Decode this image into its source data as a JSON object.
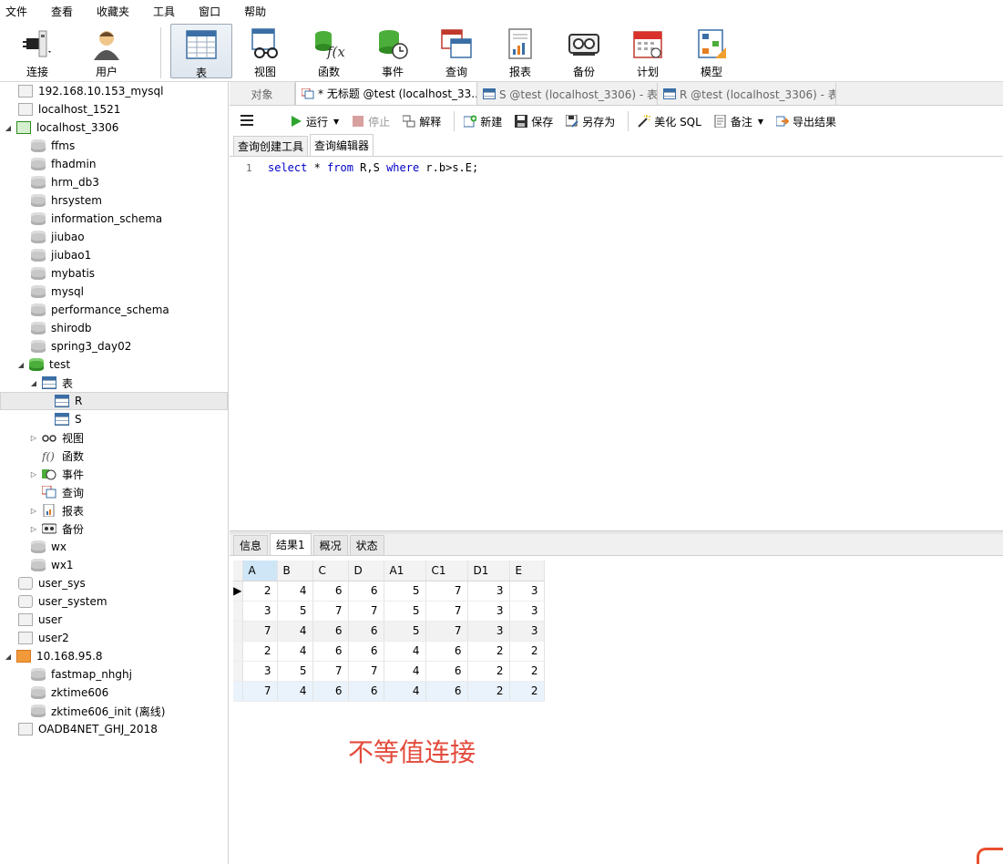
{
  "menu": [
    "文件",
    "查看",
    "收藏夹",
    "工具",
    "窗口",
    "帮助"
  ],
  "toolbar": {
    "connect": "连接",
    "user": "用户",
    "table": "表",
    "view": "视图",
    "function": "函数",
    "event": "事件",
    "query": "查询",
    "report": "报表",
    "backup": "备份",
    "schedule": "计划",
    "model": "模型"
  },
  "tree": {
    "conn1": "192.168.10.153_mysql",
    "conn2": "localhost_1521",
    "conn3": "localhost_3306",
    "dbs": [
      "ffms",
      "fhadmin",
      "hrm_db3",
      "hrsystem",
      "information_schema",
      "jiubao",
      "jiubao1",
      "mybatis",
      "mysql",
      "performance_schema",
      "shirodb",
      "spring3_day02"
    ],
    "test": "test",
    "tables": "表",
    "table_r": "R",
    "table_s": "S",
    "views": "视图",
    "functions": "函数",
    "events": "事件",
    "queries": "查询",
    "reports": "报表",
    "backups": "备份",
    "db_wx": "wx",
    "db_wx1": "wx1",
    "conn_user_sys": "user_sys",
    "conn_user_system": "user_system",
    "conn_user": "user",
    "conn_user2": "user2",
    "conn4": "10.168.95.8",
    "conn4_dbs": [
      "fastmap_nhghj",
      "zktime606",
      "zktime606_init (离线)"
    ],
    "conn5": "OADB4NET_GHJ_2018"
  },
  "tabs": {
    "objects": "对象",
    "query_tab": "* 无标题 @test (localhost_33...",
    "s_tab": "S @test (localhost_3306) - 表",
    "r_tab": "R @test (localhost_3306) - 表"
  },
  "editor_toolbar": {
    "run": "运行",
    "stop": "停止",
    "explain": "解释",
    "new": "新建",
    "save": "保存",
    "save_as": "另存为",
    "beautify": "美化 SQL",
    "comment": "备注",
    "export": "导出结果"
  },
  "subtabs": {
    "builder": "查询创建工具",
    "editor": "查询编辑器"
  },
  "code": {
    "line_no": "1",
    "kw_select": "select",
    "part1": " * ",
    "kw_from": "from",
    "part2": " R,S ",
    "kw_where": "where",
    "part3": " r.b>s.E;"
  },
  "result_tabs": {
    "info": "信息",
    "result1": "结果1",
    "profile": "概况",
    "status": "状态"
  },
  "result": {
    "columns": [
      "A",
      "B",
      "C",
      "D",
      "A1",
      "C1",
      "D1",
      "E"
    ],
    "rows": [
      [
        "2",
        "4",
        "6",
        "6",
        "5",
        "7",
        "3",
        "3"
      ],
      [
        "3",
        "5",
        "7",
        "7",
        "5",
        "7",
        "3",
        "3"
      ],
      [
        "7",
        "4",
        "6",
        "6",
        "5",
        "7",
        "3",
        "3"
      ],
      [
        "2",
        "4",
        "6",
        "6",
        "4",
        "6",
        "2",
        "2"
      ],
      [
        "3",
        "5",
        "7",
        "7",
        "4",
        "6",
        "2",
        "2"
      ],
      [
        "7",
        "4",
        "6",
        "6",
        "4",
        "6",
        "2",
        "2"
      ]
    ]
  },
  "annotation": "不等值连接",
  "colors": {
    "annotation": "#e34b3c",
    "keyword": "#0000c8",
    "run_green": "#2fa52f",
    "db_green": "#4cae3a"
  }
}
